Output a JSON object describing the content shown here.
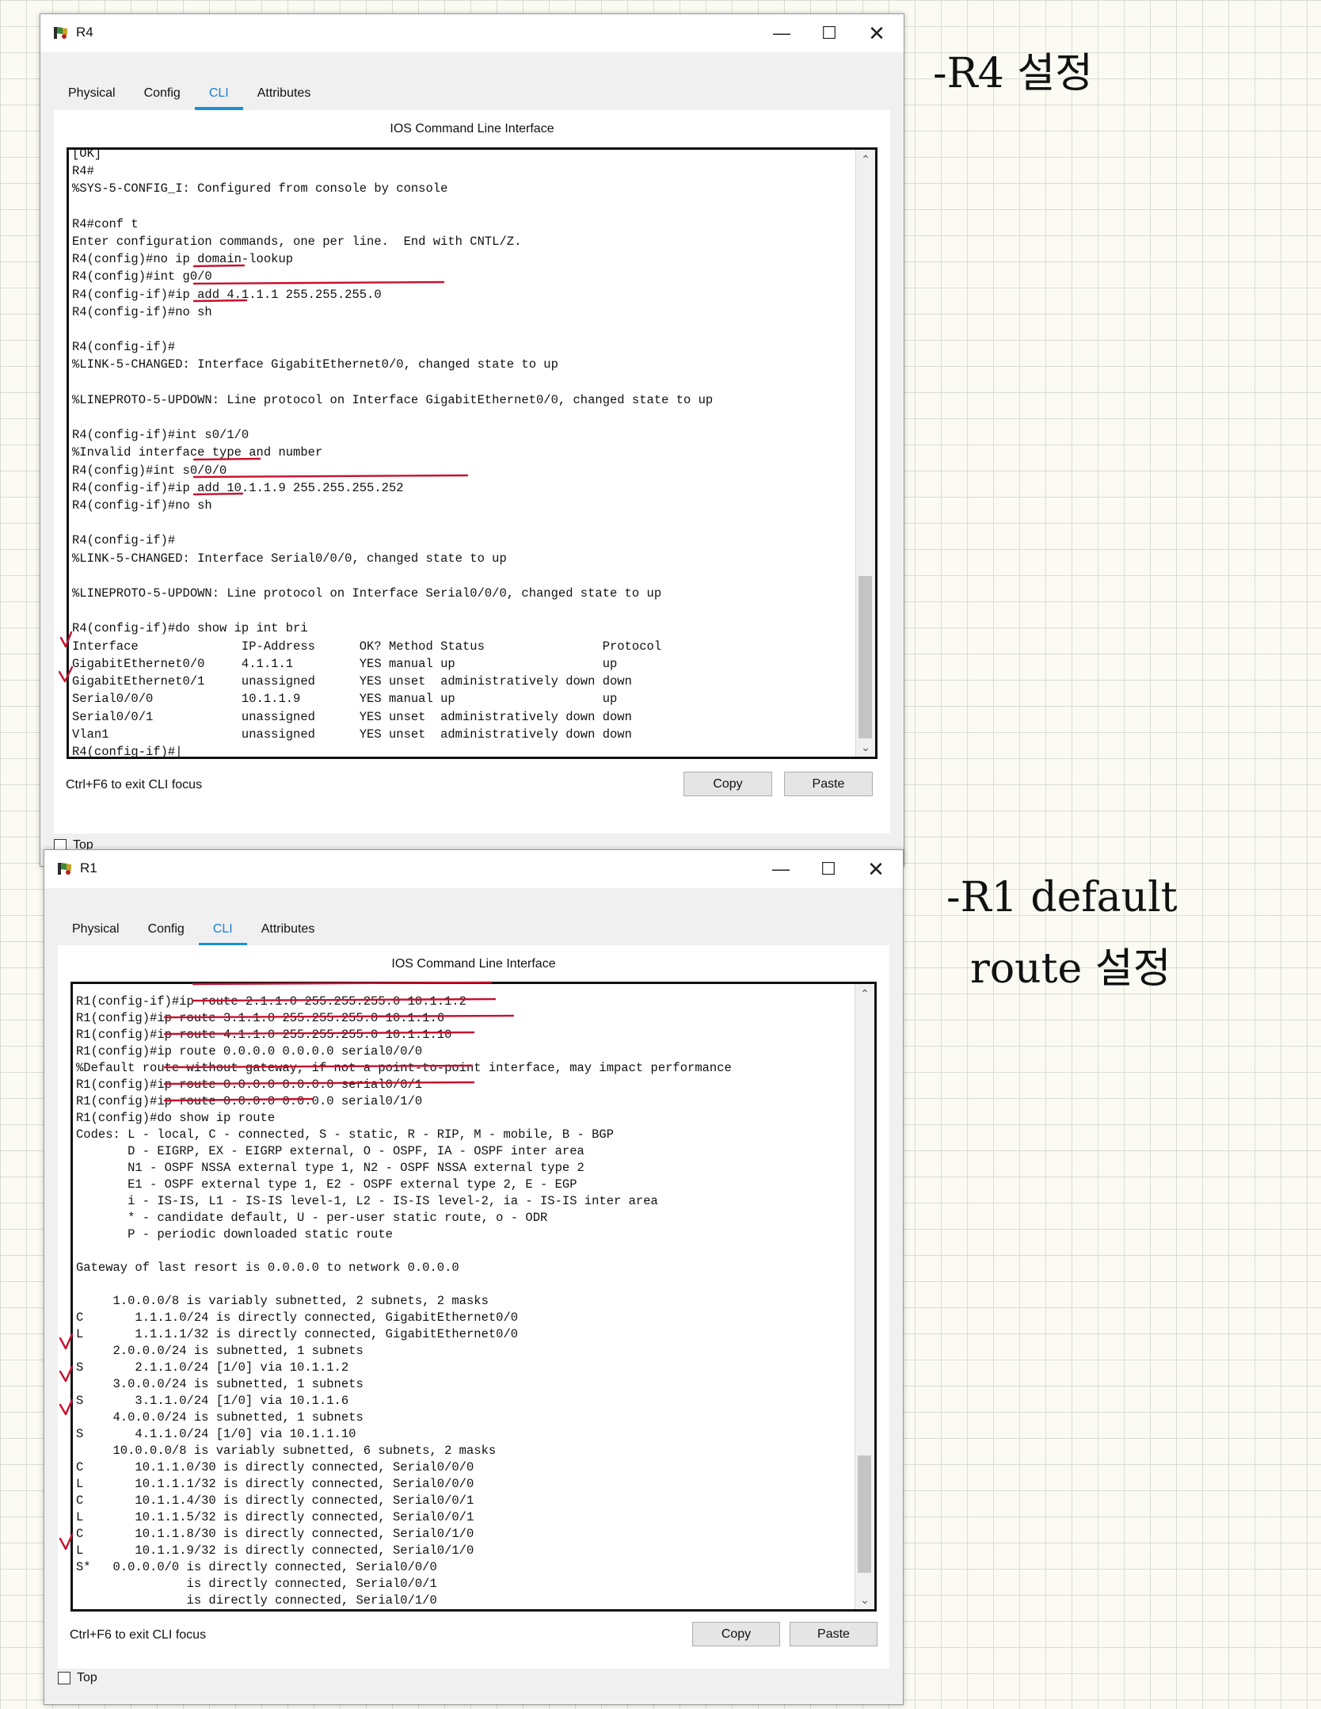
{
  "tabs_r4": [
    "Physical",
    "Config",
    "CLI",
    "Attributes"
  ],
  "tabs_r1": [
    "Physical",
    "Config",
    "CLI",
    "Attributes"
  ],
  "window_r4": {
    "title": "R4",
    "pane_title": "IOS Command Line Interface",
    "cli_text": "[OK]\nR4#\n%SYS-5-CONFIG_I: Configured from console by console\n\nR4#conf t\nEnter configuration commands, one per line.  End with CNTL/Z.\nR4(config)#no ip domain-lookup\nR4(config)#int g0/0\nR4(config-if)#ip add 4.1.1.1 255.255.255.0\nR4(config-if)#no sh\n\nR4(config-if)#\n%LINK-5-CHANGED: Interface GigabitEthernet0/0, changed state to up\n\n%LINEPROTO-5-UPDOWN: Line protocol on Interface GigabitEthernet0/0, changed state to up\n\nR4(config-if)#int s0/1/0\n%Invalid interface type and number\nR4(config)#int s0/0/0\nR4(config-if)#ip add 10.1.1.9 255.255.255.252\nR4(config-if)#no sh\n\nR4(config-if)#\n%LINK-5-CHANGED: Interface Serial0/0/0, changed state to up\n\n%LINEPROTO-5-UPDOWN: Line protocol on Interface Serial0/0/0, changed state to up\n\nR4(config-if)#do show ip int bri\nInterface              IP-Address      OK? Method Status                Protocol\nGigabitEthernet0/0     4.1.1.1         YES manual up                    up\nGigabitEthernet0/1     unassigned      YES unset  administratively down down\nSerial0/0/0            10.1.1.9        YES manual up                    up\nSerial0/0/1            unassigned      YES unset  administratively down down\nVlan1                  unassigned      YES unset  administratively down down\nR4(config-if)#|",
    "footer_hint": "Ctrl+F6 to exit CLI focus",
    "copy_label": "Copy",
    "paste_label": "Paste",
    "top_label": "Top"
  },
  "window_r1": {
    "title": "R1",
    "pane_title": "IOS Command Line Interface",
    "cli_text": "R1(config-if)#ip route 2.1.1.0 255.255.255.0 10.1.1.2\nR1(config)#ip route 3.1.1.0 255.255.255.0 10.1.1.6\nR1(config)#ip route 4.1.1.0 255.255.255.0 10.1.1.10\nR1(config)#ip route 0.0.0.0 0.0.0.0 serial0/0/0\n%Default route without gateway, if not a point-to-point interface, may impact performance\nR1(config)#ip route 0.0.0.0 0.0.0.0 serial0/0/1\nR1(config)#ip route 0.0.0.0 0.0.0.0 serial0/1/0\nR1(config)#do show ip route\nCodes: L - local, C - connected, S - static, R - RIP, M - mobile, B - BGP\n       D - EIGRP, EX - EIGRP external, O - OSPF, IA - OSPF inter area\n       N1 - OSPF NSSA external type 1, N2 - OSPF NSSA external type 2\n       E1 - OSPF external type 1, E2 - OSPF external type 2, E - EGP\n       i - IS-IS, L1 - IS-IS level-1, L2 - IS-IS level-2, ia - IS-IS inter area\n       * - candidate default, U - per-user static route, o - ODR\n       P - periodic downloaded static route\n\nGateway of last resort is 0.0.0.0 to network 0.0.0.0\n\n     1.0.0.0/8 is variably subnetted, 2 subnets, 2 masks\nC       1.1.1.0/24 is directly connected, GigabitEthernet0/0\nL       1.1.1.1/32 is directly connected, GigabitEthernet0/0\n     2.0.0.0/24 is subnetted, 1 subnets\nS       2.1.1.0/24 [1/0] via 10.1.1.2\n     3.0.0.0/24 is subnetted, 1 subnets\nS       3.1.1.0/24 [1/0] via 10.1.1.6\n     4.0.0.0/24 is subnetted, 1 subnets\nS       4.1.1.0/24 [1/0] via 10.1.1.10\n     10.0.0.0/8 is variably subnetted, 6 subnets, 2 masks\nC       10.1.1.0/30 is directly connected, Serial0/0/0\nL       10.1.1.1/32 is directly connected, Serial0/0/0\nC       10.1.1.4/30 is directly connected, Serial0/0/1\nL       10.1.1.5/32 is directly connected, Serial0/0/1\nC       10.1.1.8/30 is directly connected, Serial0/1/0\nL       10.1.1.9/32 is directly connected, Serial0/1/0\nS*   0.0.0.0/0 is directly connected, Serial0/0/0\n               is directly connected, Serial0/0/1\n               is directly connected, Serial0/1/0",
    "footer_hint": "Ctrl+F6 to exit CLI focus",
    "copy_label": "Copy",
    "paste_label": "Paste",
    "top_label": "Top"
  },
  "annotations": {
    "note_r4": "-R4 설정",
    "note_r1_line1": "-R1 default",
    "note_r1_line2": "route 설정"
  },
  "colors": {
    "tab_accent": "#1a8fd8",
    "annotation_red": "#c8102e"
  },
  "icons": [
    "router-app-icon",
    "minimize-icon",
    "maximize-icon",
    "close-icon",
    "scroll-up-icon",
    "scroll-down-icon",
    "checkbox-icon",
    "checkmark-icon"
  ]
}
